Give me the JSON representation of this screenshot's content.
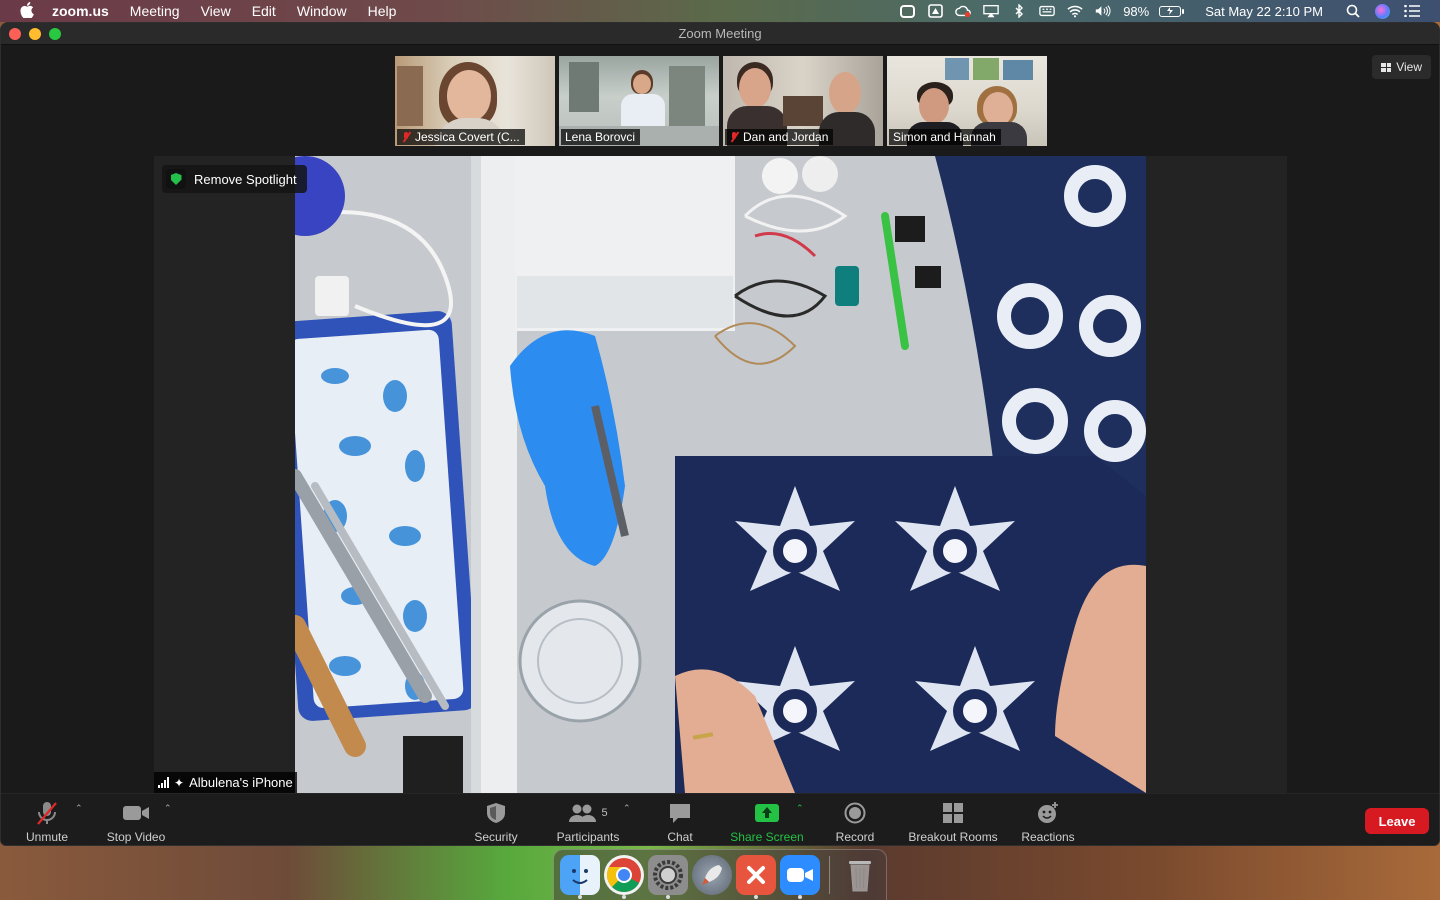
{
  "menubar": {
    "app_name": "zoom.us",
    "menus": [
      "Meeting",
      "View",
      "Edit",
      "Window",
      "Help"
    ],
    "battery": "98%",
    "datetime": "Sat May 22  2:10 PM"
  },
  "window": {
    "title": "Zoom Meeting"
  },
  "view_button": {
    "label": "View"
  },
  "thumbnails": [
    {
      "name": "Jessica Covert (C...",
      "muted": true
    },
    {
      "name": "Lena Borovci",
      "muted": false
    },
    {
      "name": "Dan and Jordan",
      "muted": true
    },
    {
      "name": "Simon and Hannah",
      "muted": false
    }
  ],
  "spotlight": {
    "remove_label": "Remove Spotlight",
    "device_name": "Albulena's iPhone"
  },
  "toolbar": {
    "unmute": "Unmute",
    "stop_video": "Stop Video",
    "security": "Security",
    "participants": "Participants",
    "participants_count": "5",
    "chat": "Chat",
    "share_screen": "Share Screen",
    "record": "Record",
    "breakout_rooms": "Breakout Rooms",
    "reactions": "Reactions",
    "leave": "Leave"
  },
  "colors": {
    "share_green": "#23c144",
    "leave_red": "#d71921",
    "spotlight_shield": "#24c04a"
  }
}
